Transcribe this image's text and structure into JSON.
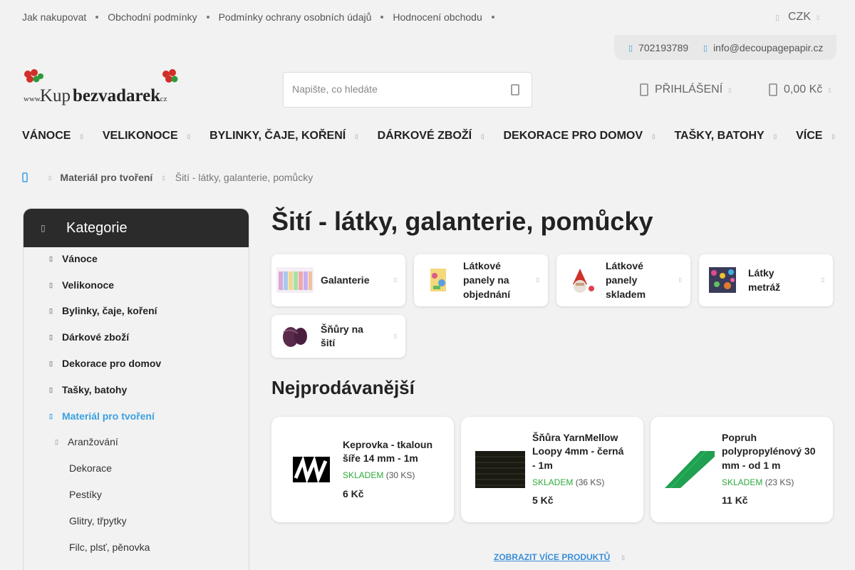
{
  "top_links": [
    "Jak nakupovat",
    "Obchodní podmínky",
    "Podmínky ochrany osobních údajů",
    "Hodnocení obchodu"
  ],
  "currency": "CZK",
  "contact": {
    "phone": "702193789",
    "email": "info@decoupagepapir.cz"
  },
  "logo": {
    "prefix": "www.",
    "part1": "Kup",
    "part2": "bezvadarek",
    "suffix": ".cz"
  },
  "search": {
    "placeholder": "Napište, co hledáte"
  },
  "account": {
    "login_label": "PŘIHLÁŠENÍ",
    "cart_total": "0,00 Kč"
  },
  "main_nav": [
    "VÁNOCE",
    "VELIKONOCE",
    "BYLINKY, ČAJE, KOŘENÍ",
    "DÁRKOVÉ ZBOŽÍ",
    "DEKORACE PRO DOMOV",
    "TAŠKY, BATOHY",
    "VÍCE"
  ],
  "breadcrumb": {
    "parent": "Materiál pro tvoření",
    "current": "Šití - látky, galanterie, pomůcky"
  },
  "sidebar": {
    "title": "Kategorie",
    "top_categories": [
      "Vánoce",
      "Velikonoce",
      "Bylinky, čaje, koření",
      "Dárkové zboží",
      "Dekorace pro domov",
      "Tašky, batohy"
    ],
    "active_category": "Materiál pro tvoření",
    "open_subcategory": "Aranžování",
    "leaf_items": [
      "Dekorace",
      "Pestíky",
      "Glitry, třpytky",
      "Filc, plsť, pěnovka"
    ]
  },
  "page_title": "Šití - látky, galanterie, pomůcky",
  "subcategories": [
    {
      "name_lines": [
        "Galanterie"
      ]
    },
    {
      "name_lines": [
        "Látkové",
        "panely na",
        "objednání"
      ]
    },
    {
      "name_lines": [
        "Látkové",
        "panely",
        "skladem"
      ]
    },
    {
      "name_lines": [
        "Látky",
        "metráž"
      ]
    },
    {
      "name_lines": [
        "Šňůry na",
        "šití"
      ]
    }
  ],
  "bestsellers": {
    "title": "Nejprodávanější",
    "products": [
      {
        "name_lines": [
          "Keprovka - tkaloun",
          "šíře 14 mm - 1m"
        ],
        "stock_label": "SKLADEM",
        "stock_qty": "(30 KS)",
        "price": "6 Kč"
      },
      {
        "name_lines": [
          "Šňůra YarnMellow",
          "Loopy 4mm - černá",
          "- 1m"
        ],
        "stock_label": "SKLADEM",
        "stock_qty": "(36 KS)",
        "price": "5 Kč"
      },
      {
        "name_lines": [
          "Popruh",
          "polypropylénový 30",
          "mm - od 1 m"
        ],
        "stock_label": "SKLADEM",
        "stock_qty": "(23 KS)",
        "price": "11 Kč"
      }
    ],
    "show_more": "ZOBRAZIT VÍCE PRODUKTŮ"
  },
  "colors": {
    "accent_blue": "#3aa0e0",
    "stock_green": "#2eaa3c",
    "sidebar_header": "#2b2b2b"
  }
}
